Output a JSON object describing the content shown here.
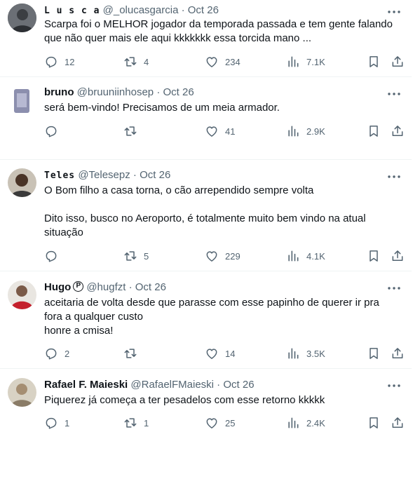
{
  "tweets": [
    {
      "name": "L u s c a",
      "handle": "@_olucasgarcia",
      "date": "Oct 26",
      "verified_badge": "",
      "text": "Scarpa foi o MELHOR jogador da temporada passada e tem gente falando\nque não quer mais ele aqui kkkkkkk essa torcida mano ...",
      "replies": "12",
      "retweets": "4",
      "likes": "234",
      "views": "7.1K"
    },
    {
      "name": "bruno",
      "handle": "@bruuniinhosep",
      "date": "Oct 26",
      "verified_badge": "",
      "text": "será bem-vindo! Precisamos de um meia armador.",
      "replies": "",
      "retweets": "",
      "likes": "41",
      "views": "2.9K"
    },
    {
      "name": "Teles",
      "handle": "@Telesepz",
      "date": "Oct 26",
      "verified_badge": "",
      "text": "O Bom filho a casa torna, o cão arrependido sempre volta\n\nDito isso, busco no Aeroporto, é totalmente muito bem vindo na atual\nsituação",
      "replies": "",
      "retweets": "5",
      "likes": "229",
      "views": "4.1K"
    },
    {
      "name": "Hugo",
      "handle": "@hugfzt",
      "date": "Oct 26",
      "verified_badge": "P",
      "text": "aceitaria de volta desde que parasse com esse papinho de querer ir pra\nfora a qualquer custo\nhonre a cmisa!",
      "replies": "2",
      "retweets": "",
      "likes": "14",
      "views": "3.5K"
    },
    {
      "name": "Rafael F. Maieski",
      "handle": "@RafaelFMaieski",
      "date": "Oct 26",
      "verified_badge": "",
      "text": "Piquerez já começa a ter pesadelos com esse retorno kkkkk",
      "replies": "1",
      "retweets": "1",
      "likes": "25",
      "views": "2.4K"
    }
  ],
  "separator": "·",
  "icons": {
    "reply": "reply-icon",
    "retweet": "retweet-icon",
    "like": "heart-icon",
    "views": "views-icon",
    "bookmark": "bookmark-icon",
    "share": "share-icon",
    "more": "more-icon"
  },
  "colors": {
    "text": "#0f1419",
    "secondary": "#536471",
    "divider": "#eff3f4"
  }
}
